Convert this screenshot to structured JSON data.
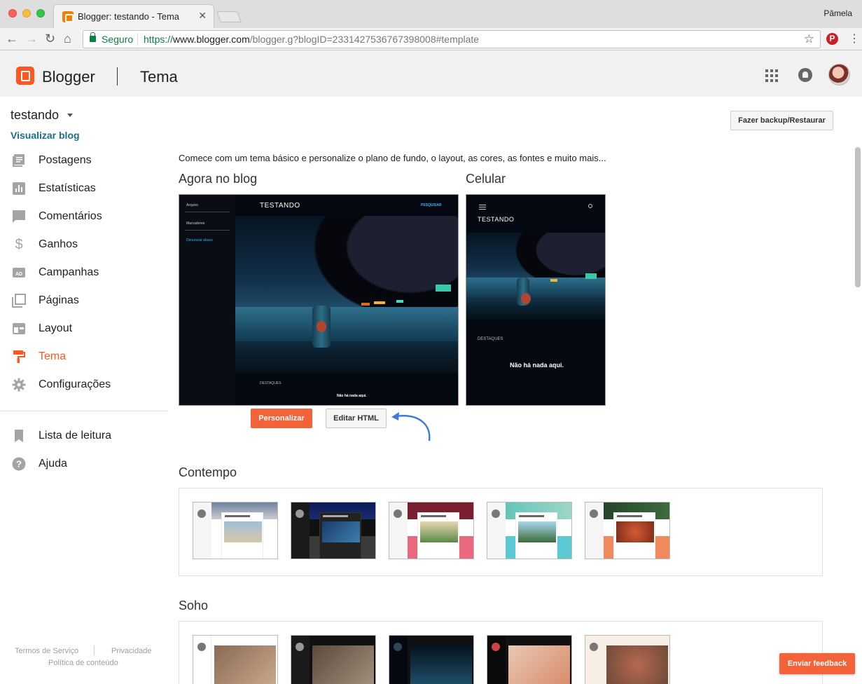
{
  "browser": {
    "tab_title": "Blogger: testando - Tema",
    "user": "Pâmela",
    "secure_label": "Seguro",
    "url_proto": "https://",
    "url_host": "www.blogger.com",
    "url_path": "/blogger.g?blogID=2331427536767398008#template"
  },
  "header": {
    "app_name": "Blogger",
    "page_title": "Tema"
  },
  "sidebar": {
    "blog_name": "testando",
    "view_blog": "Visualizar blog",
    "items": [
      {
        "label": "Postagens",
        "icon": "posts-icon"
      },
      {
        "label": "Estatísticas",
        "icon": "stats-icon"
      },
      {
        "label": "Comentários",
        "icon": "comments-icon"
      },
      {
        "label": "Ganhos",
        "icon": "dollar-icon"
      },
      {
        "label": "Campanhas",
        "icon": "ad-icon"
      },
      {
        "label": "Páginas",
        "icon": "pages-icon"
      },
      {
        "label": "Layout",
        "icon": "layout-icon"
      },
      {
        "label": "Tema",
        "icon": "paint-roller-icon",
        "active": true
      },
      {
        "label": "Configurações",
        "icon": "gear-icon"
      }
    ],
    "secondary": [
      {
        "label": "Lista de leitura",
        "icon": "bookmark-icon"
      },
      {
        "label": "Ajuda",
        "icon": "help-icon"
      }
    ],
    "footer": {
      "terms": "Termos de Serviço",
      "privacy": "Privacidade",
      "content_policy": "Política de conteúdo"
    }
  },
  "main": {
    "backup_button": "Fazer backup/Restaurar",
    "intro": "Comece com um tema básico e personalize o plano de fundo, o layout, as cores, as fontes e muito mais...",
    "current_title": "Agora no blog",
    "mobile_title": "Celular",
    "preview": {
      "blog_title": "TESTANDO",
      "search": "PESQUISAR",
      "archives": "Arquivo",
      "labels": "Marcadores",
      "report_abuse": "Denunciar abuso",
      "highlights": "DESTAQUES",
      "nothing_here": "Não há nada aqui."
    },
    "customize_button": "Personalizar",
    "edit_html_button": "Editar HTML",
    "sections": [
      {
        "title": "Contempo"
      },
      {
        "title": "Soho"
      }
    ]
  },
  "feedback_button": "Enviar feedback",
  "colors": {
    "accent": "#ff5722",
    "button_orange": "#f4623a",
    "link_teal": "#1a6f8a",
    "arrow_blue": "#3d7bd9"
  }
}
